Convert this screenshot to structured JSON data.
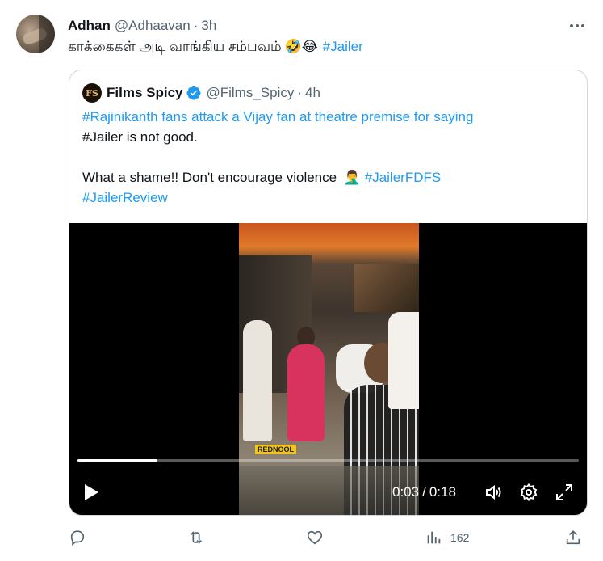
{
  "tweet": {
    "author_name": "Adhan",
    "author_handle": "@Adhaavan",
    "separator": "·",
    "time": "3h",
    "text": "காக்கைகள் அடி வாங்கிய சம்பவம்",
    "emojis": "🤣😂",
    "hashtag": "#Jailer"
  },
  "quote": {
    "author_name": "Films Spicy",
    "author_handle": "@Films_Spicy",
    "separator": "·",
    "time": "4h",
    "verified": true,
    "avatar_initials": "FS",
    "line1": "#Rajinikanth fans attack a Vijay fan at theatre premise for saying",
    "line2": "#Jailer is not good.",
    "line3_text": "What a shame!! Don't encourage violence",
    "line3_emoji": "🤦‍♂️",
    "line3_hashtag": "#JailerFDFS",
    "line4": "#JailerReview"
  },
  "video": {
    "watermark": "REDNOOL",
    "current_time": "0:03",
    "time_separator": "/",
    "duration": "0:18",
    "progress_fraction": 0.16
  },
  "actions": {
    "views": "162"
  },
  "colors": {
    "link": "#1d9bf0",
    "muted": "#536471",
    "verified": "#1d9bf0",
    "border": "#cfd9de"
  }
}
